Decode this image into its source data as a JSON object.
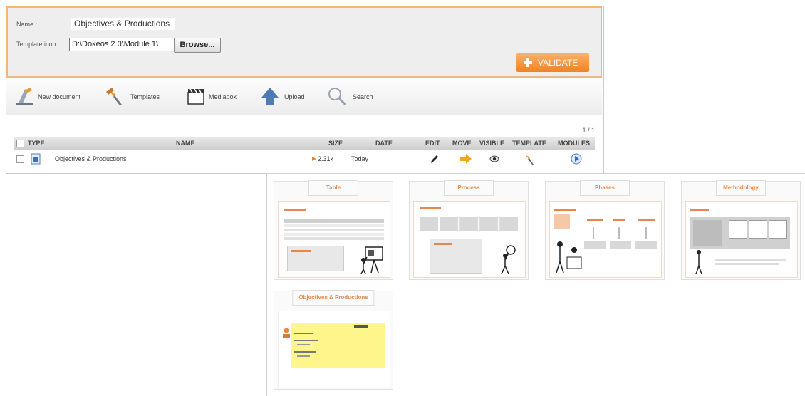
{
  "form": {
    "name_label": "Name :",
    "name_value": "Objectives & Productions",
    "template_icon_label": "Template icon",
    "file_value": "D:\\Dokeos 2.0\\Module 1\\",
    "browse_label": "Browse...",
    "validate_label": "VALIDATE"
  },
  "toolbar": {
    "new_document": "New document",
    "templates": "Templates",
    "mediabox": "Mediabox",
    "upload": "Upload",
    "search": "Search"
  },
  "table": {
    "pager": "1 / 1",
    "headers": {
      "type": "TYPE",
      "name": "NAME",
      "size": "SIZE",
      "date": "DATE",
      "edit": "EDIT",
      "move": "MOVE",
      "visible": "VISIBLE",
      "template": "TEMPLATE",
      "modules": "MODULES"
    },
    "rows": [
      {
        "name": "Objectives & Productions",
        "size": "2.31k",
        "date": "Today"
      }
    ]
  },
  "templates_panel": {
    "cards": [
      {
        "title": "Table"
      },
      {
        "title": "Process"
      },
      {
        "title": "Phases"
      },
      {
        "title": "Methodology"
      },
      {
        "title": "Objectives & Productions"
      }
    ]
  },
  "colors": {
    "accent": "#f08224",
    "form_border": "#f1b67a",
    "card_title": "#e58a4a",
    "note_yellow": "#fef68a"
  }
}
